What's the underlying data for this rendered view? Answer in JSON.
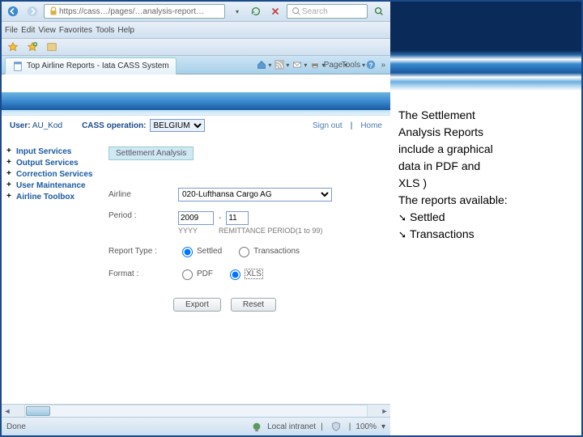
{
  "browser": {
    "address": "https://cass…/pages/…analysis-report…",
    "search_placeholder": "Search",
    "menus": [
      "File",
      "Edit",
      "View",
      "Favorites",
      "Tools",
      "Help"
    ],
    "tab_title": "Top Airline Reports - Iata CASS System",
    "toolbar": {
      "page": "Page",
      "tools": "Tools"
    },
    "status": {
      "done": "Done",
      "zone": "Local intranet",
      "zoom": "100%"
    }
  },
  "header": {
    "user_label": "User:",
    "user_value": "AU_Kod",
    "cass_label": "CASS operation:",
    "cass_value": "BELGIUM",
    "signout": "Sign out",
    "home": "Home"
  },
  "nav": {
    "items": [
      {
        "label": "Input Services"
      },
      {
        "label": "Output Services"
      },
      {
        "label": "Correction Services"
      },
      {
        "label": "User Maintenance"
      },
      {
        "label": "Airline Toolbox"
      }
    ]
  },
  "form": {
    "section": "Settlement Analysis",
    "airline_label": "Airline",
    "airline_value": "020-Lufthansa Cargo AG",
    "period_label": "Period :",
    "period_year": "2009",
    "period_num": "11",
    "period_dash": "-",
    "period_y_hint": "YYYY",
    "period_n_hint": "REMITTANCE PERIOD(1 to 99)",
    "report_label": "Report Type :",
    "rt_settled": "Settled",
    "rt_trans": "Transactions",
    "format_label": "Format :",
    "fmt_pdf": "PDF",
    "fmt_xls": "XLS",
    "export": "Export",
    "reset": "Reset"
  },
  "sidetext": {
    "l1": "The Settlement",
    "l2": "Analysis Reports",
    "l3": "include a graphical",
    "l4": "data in PDF and",
    "l5": "XLS )",
    "l6": "The reports available:",
    "b1": "Settled",
    "b2": "Transactions"
  }
}
